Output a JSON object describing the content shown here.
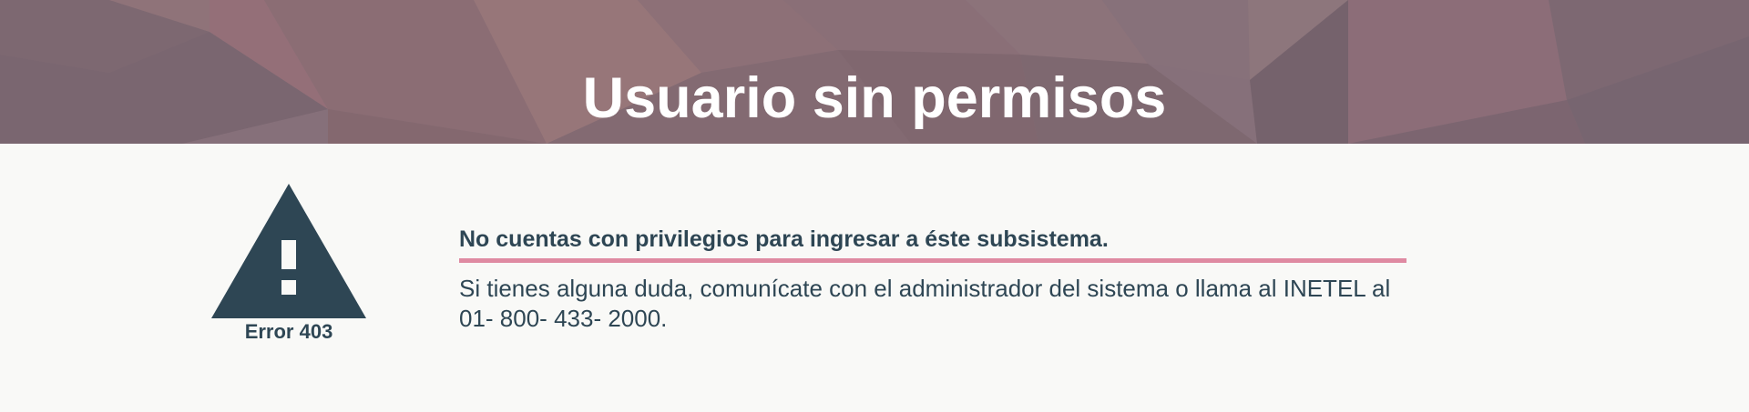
{
  "banner": {
    "title": "Usuario sin permisos"
  },
  "warning": {
    "icon": "warning-triangle-icon",
    "error_code": "Error 403"
  },
  "message": {
    "heading": "No cuentas con privilegios para ingresar a éste subsistema.",
    "body": "Si tienes alguna duda, comunícate con el administrador del sistema o llama al INETEL al 01- 800- 433- 2000."
  },
  "colors": {
    "banner": "#86707a",
    "text": "#2e4654",
    "accent": "#df8aa2",
    "background": "#f9f9f7"
  }
}
